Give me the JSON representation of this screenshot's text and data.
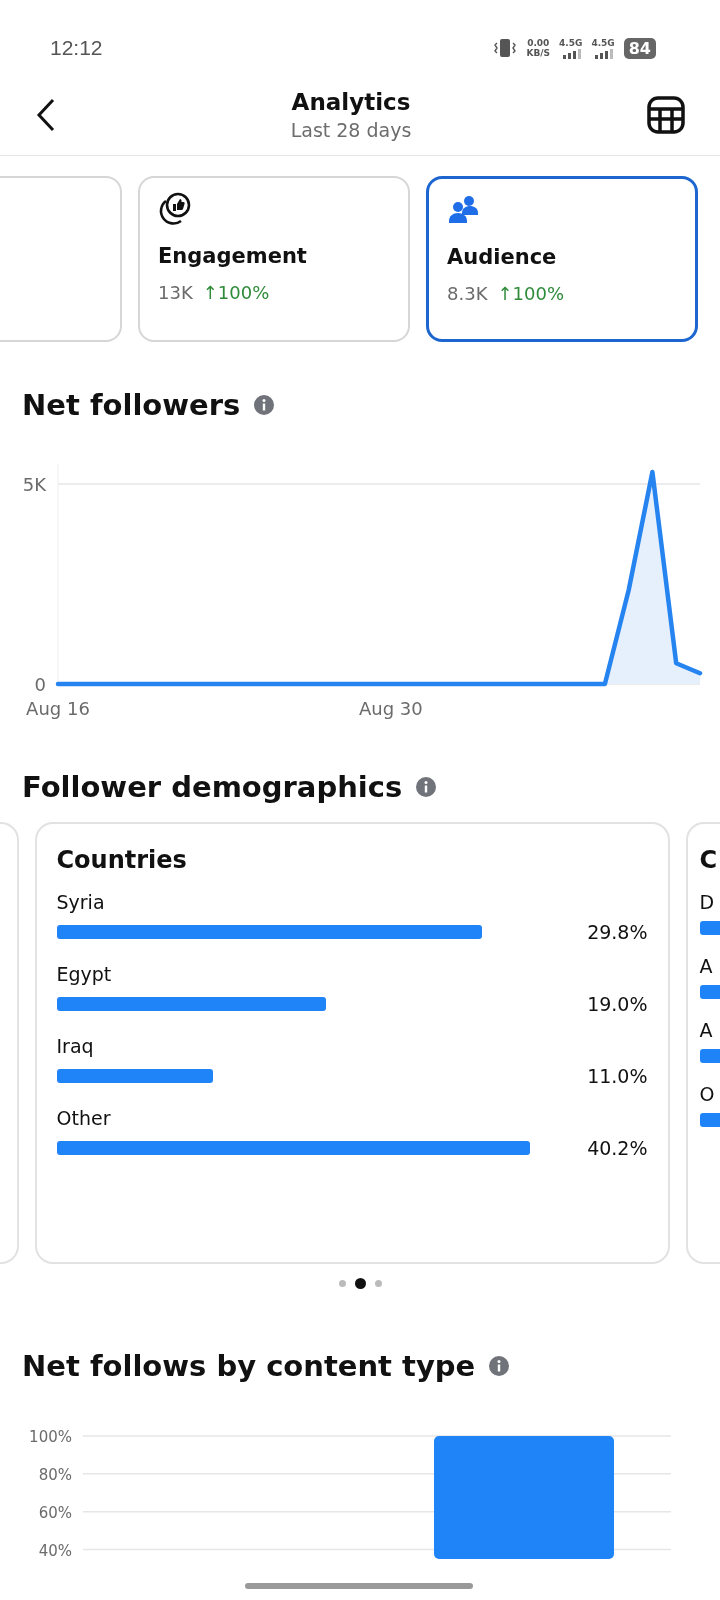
{
  "status_bar": {
    "time": "12:12",
    "net_speed": "0.00",
    "net_unit": "KB/S",
    "signal_1": "4.5G",
    "signal_2": "4.5G",
    "battery": "84"
  },
  "header": {
    "title": "Analytics",
    "subtitle": "Last 28 days"
  },
  "metric_cards": [
    {
      "kind": "engagement",
      "label": "Engagement",
      "value": "13K",
      "change": "↑100%",
      "selected": false
    },
    {
      "kind": "audience",
      "label": "Audience",
      "value": "8.3K",
      "change": "↑100%",
      "selected": true
    }
  ],
  "net_followers": {
    "title": "Net followers",
    "chart_data": {
      "type": "area",
      "ylim": [
        0,
        5500
      ],
      "categories": [
        "Aug 16",
        null,
        null,
        null,
        null,
        null,
        null,
        null,
        null,
        null,
        null,
        null,
        null,
        null,
        "Aug 30",
        null,
        null,
        null,
        null,
        null,
        null,
        null,
        null,
        null,
        null,
        null,
        null,
        null
      ],
      "yticks": [
        {
          "value": 0,
          "label": "0"
        },
        {
          "value": 5000,
          "label": "5K"
        }
      ],
      "series": [
        {
          "color": "#2684f0",
          "values": [
            0,
            0,
            0,
            0,
            0,
            0,
            0,
            0,
            0,
            0,
            0,
            0,
            0,
            0,
            0,
            0,
            0,
            0,
            0,
            0,
            0,
            0,
            0,
            0,
            2350,
            5300,
            520,
            270
          ]
        }
      ]
    }
  },
  "demographics": {
    "title": "Follower demographics",
    "card": {
      "title": "Countries",
      "rows": [
        {
          "label": "Syria",
          "level": 0.9,
          "value": "29.8%"
        },
        {
          "label": "Egypt",
          "level": 0.57,
          "value": "19.0%"
        },
        {
          "label": "Iraq",
          "level": 0.33,
          "value": "11.0%"
        },
        {
          "label": "Other",
          "level": 1.0,
          "value": "40.2%"
        }
      ]
    },
    "next_card": {
      "title": "C",
      "labels": [
        "D",
        "A",
        "A",
        "O"
      ]
    },
    "pager": [
      {
        "selected": false
      },
      {
        "selected": true
      },
      {
        "selected": false
      }
    ]
  },
  "content_type": {
    "title": "Net follows by content type",
    "chart_data": {
      "type": "bar",
      "grid": true,
      "ylim": [
        35,
        100
      ],
      "yticks": [
        {
          "value": 40,
          "label": "40%"
        },
        {
          "value": 60,
          "label": "60%"
        },
        {
          "value": 80,
          "label": "80%"
        },
        {
          "value": 100,
          "label": "100%"
        }
      ],
      "series": [
        {
          "color": "#1f84f7",
          "values": [
            null,
            100
          ]
        }
      ]
    }
  }
}
